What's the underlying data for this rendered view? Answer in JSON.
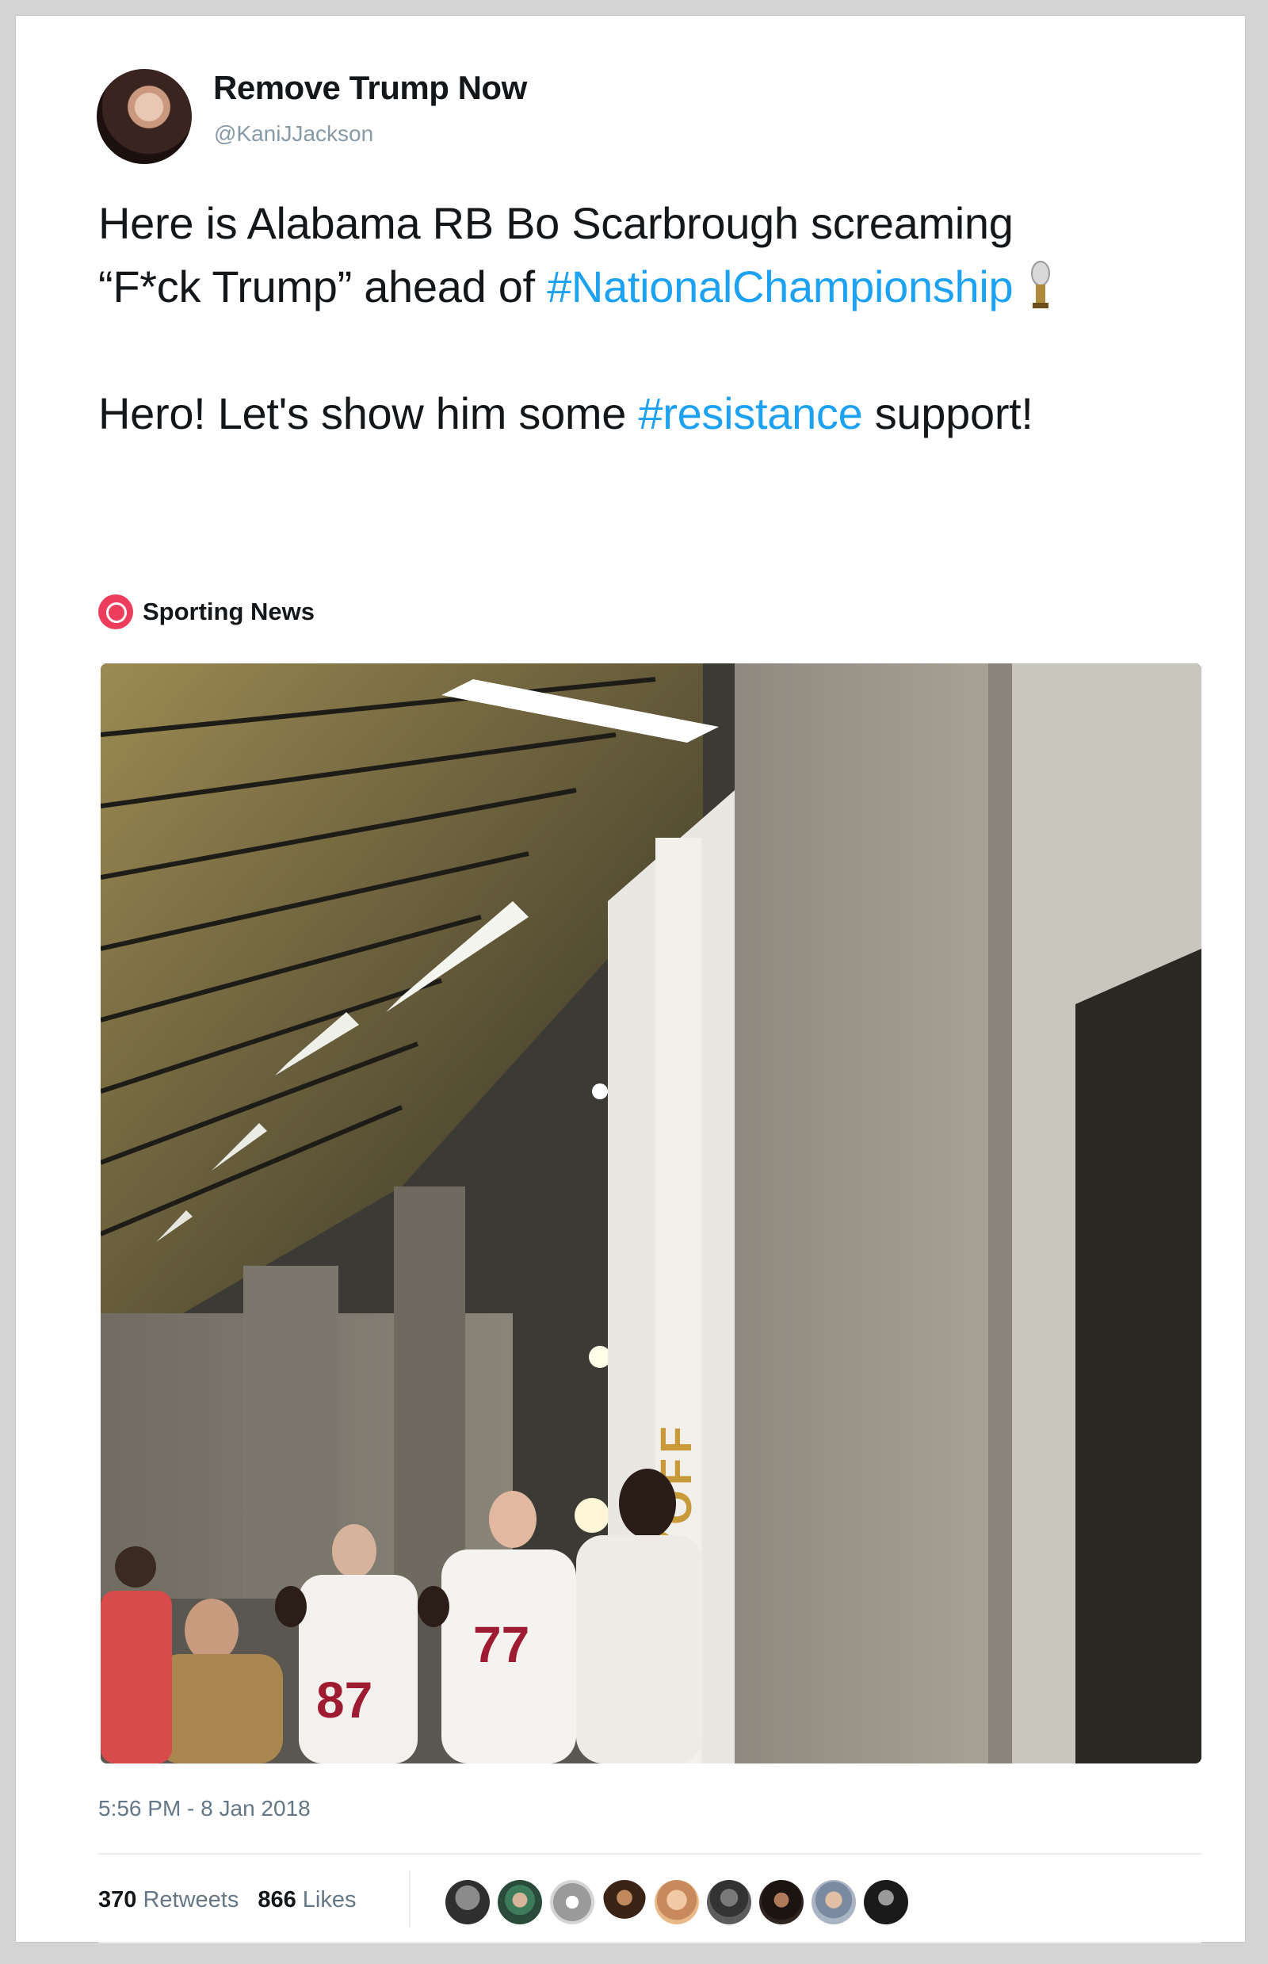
{
  "tweet": {
    "author": {
      "display_name": "Remove Trump Now",
      "handle": "@KaniJJackson",
      "avatar_icon": "user-avatar"
    },
    "text_line1": "Here is Alabama RB Bo Scarbrough screaming “F*ck Trump” ahead of",
    "hashtag1": "#NationalChampionship",
    "trophy_icon": "trophy-icon",
    "text_line2_prefix": "Hero! Let's show him some",
    "hashtag2": "#resistance",
    "text_line2_suffix": "support!",
    "source": {
      "name": "Sporting News",
      "icon": "sporting-news-logo"
    },
    "media": {
      "wall_text": "CFBPLAYOFF",
      "jersey_numbers": [
        "87",
        "77"
      ]
    },
    "timestamp": "5:56 PM - 8 Jan 2018",
    "stats": {
      "retweets_count": "370",
      "retweets_label": "Retweets",
      "likes_count": "866",
      "likes_label": "Likes"
    },
    "liker_avatars": 9
  },
  "colors": {
    "hashtag": "#1da1f2",
    "text": "#14171a",
    "muted": "#657786",
    "brand_red": "#ec3e5c"
  }
}
